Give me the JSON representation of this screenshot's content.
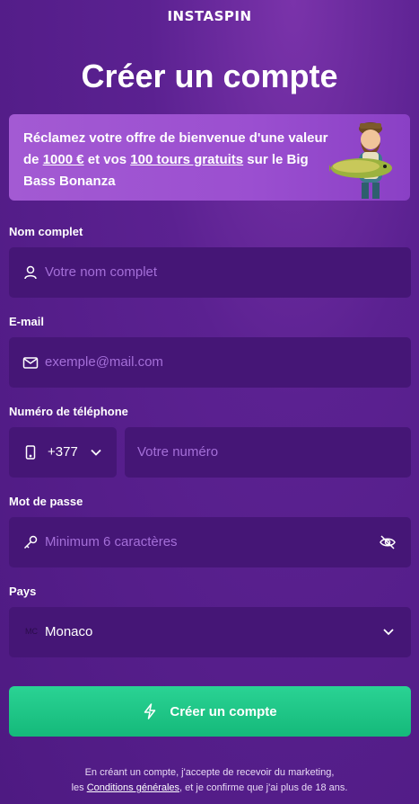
{
  "header": {
    "logo_text": "INSTASPIN"
  },
  "page_title": "Créer un compte",
  "promo": {
    "text_part1": "Réclamez votre offre de bienvenue d'une valeur de ",
    "amount": "1000 €",
    "text_part2": " et vos ",
    "spins": "100 tours gratuits",
    "text_part3": " sur le Big Bass Bonanza"
  },
  "form": {
    "full_name": {
      "label": "Nom complet",
      "placeholder": "Votre nom complet",
      "icon": "user-icon"
    },
    "email": {
      "label": "E-mail",
      "placeholder": "exemple@mail.com",
      "icon": "mail-icon"
    },
    "phone": {
      "label": "Numéro de téléphone",
      "code": "+377",
      "placeholder": "Votre numéro",
      "icon": "phone-icon"
    },
    "password": {
      "label": "Mot de passe",
      "placeholder": "Minimum 6 caractères",
      "icon": "key-icon"
    },
    "country": {
      "label": "Pays",
      "flag_code": "MC",
      "value": "Monaco"
    }
  },
  "submit": {
    "label": "Créer un compte",
    "icon": "lightning-icon"
  },
  "legal": {
    "line1": "En créant un compte, j'accepte de recevoir du marketing,",
    "prefix": "les ",
    "link": "Conditions générales",
    "suffix": ", et je confirme que j'ai plus de 18 ans."
  },
  "colors": {
    "background": "#5b2191",
    "field": "#451676",
    "placeholder": "#a46fd8",
    "promo": "#9b4fd0",
    "cta": "#1cc585"
  }
}
